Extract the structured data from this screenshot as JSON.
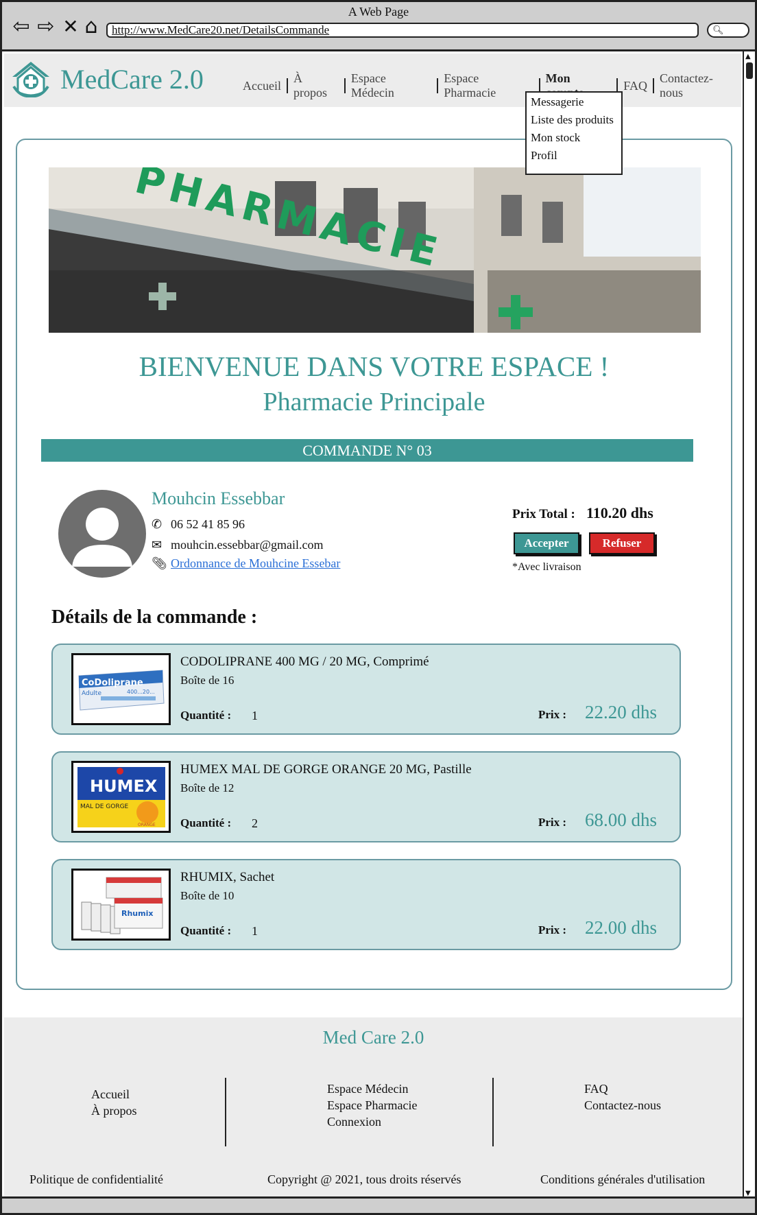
{
  "browser": {
    "window_title": "A Web Page",
    "url": "http://www.MedCare20.net/DetailsCommande"
  },
  "header": {
    "logo_text": "MedCare 2.0",
    "nav": [
      {
        "label": "Accueil"
      },
      {
        "label": "À propos"
      },
      {
        "label": "Espace Médecin"
      },
      {
        "label": "Espace Pharmacie"
      },
      {
        "label": "Mon compte"
      },
      {
        "label": "FAQ"
      },
      {
        "label": "Contactez-nous"
      }
    ],
    "dropdown": [
      "Messagerie",
      "Liste des produits",
      "Mon stock",
      "Profil"
    ]
  },
  "banner": {
    "sign_text": "PHARMACIE"
  },
  "main": {
    "welcome": "BIENVENUE DANS VOTRE ESPACE !",
    "pharmacy_name": "Pharmacie Principale",
    "order_title": "COMMANDE N° 03",
    "patient": {
      "name": "Mouhcin Essebbar",
      "phone": "06 52 41 85 96",
      "email": "mouhcin.essebbar@gmail.com",
      "prescription_link": "Ordonnance de Mouhcine Essebar"
    },
    "total_label": "Prix Total :",
    "total_value": "110.20 dhs",
    "accept_label": "Accepter",
    "refuse_label": "Refuser",
    "delivery_note": "*Avec livraison",
    "details_title": "Détails de la commande :",
    "quantity_label": "Quantité :",
    "price_label": "Prix :",
    "products": [
      {
        "name": "CODOLIPRANE 400 MG / 20 MG, Comprimé",
        "box": "Boîte de 16",
        "quantity": "1",
        "price": "22.20 dhs",
        "img_brand": "CoDoliprane",
        "img_sub": "Adulte",
        "img_dose": "400...20..."
      },
      {
        "name": "HUMEX MAL DE GORGE ORANGE 20 MG, Pastille",
        "box": "Boîte de 12",
        "quantity": "2",
        "price": "68.00 dhs",
        "img_brand": "HUMEX",
        "img_sub": "MAL DE GORGE",
        "img_dose": "ORANGE"
      },
      {
        "name": "RHUMIX, Sachet",
        "box": "Boîte de 10",
        "quantity": "1",
        "price": "22.00 dhs",
        "img_brand": "Rhumix"
      }
    ]
  },
  "footer": {
    "title": "Med Care 2.0",
    "col1": [
      "Accueil",
      "À propos"
    ],
    "col2": [
      "Espace Médecin",
      "Espace Pharmacie",
      "Connexion"
    ],
    "col3": [
      "FAQ",
      "Contactez-nous"
    ],
    "privacy": "Politique de confidentialité",
    "copyright": "Copyright @ 2021, tous droits réservés",
    "terms": "Conditions générales d'utilisation"
  },
  "colors": {
    "brand": "#3d9794",
    "product_card": "#d1e6e6",
    "refuse": "#d62a2a"
  }
}
